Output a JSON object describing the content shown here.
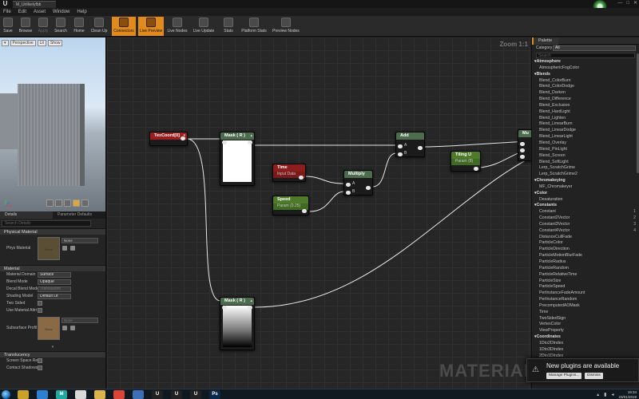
{
  "titlebar": {
    "logo": "U",
    "tab_title": "M_Unlikelyfbb",
    "min": "—",
    "max": "□",
    "close": "✕"
  },
  "menu": [
    "File",
    "Edit",
    "Asset",
    "Window",
    "Help"
  ],
  "toolbar": [
    {
      "label": "Save",
      "icon": "save-icon",
      "state": "normal"
    },
    {
      "label": "Browse",
      "icon": "browse-icon",
      "state": "normal"
    },
    {
      "label": "Apply",
      "icon": "apply-icon",
      "state": "dim"
    },
    {
      "label": "Search",
      "icon": "search-icon",
      "state": "normal"
    },
    {
      "label": "Home",
      "icon": "home-icon",
      "state": "normal"
    },
    {
      "label": "Clean Up",
      "icon": "cleanup-icon",
      "state": "normal"
    },
    {
      "label": "Connectors",
      "icon": "connectors-icon",
      "state": "active"
    },
    {
      "label": "Live Preview",
      "icon": "live-preview-icon",
      "state": "active"
    },
    {
      "label": "Live Nodes",
      "icon": "live-nodes-icon",
      "state": "normal"
    },
    {
      "label": "Live Update",
      "icon": "live-update-icon",
      "state": "normal"
    },
    {
      "label": "Stats",
      "icon": "stats-icon",
      "state": "normal"
    },
    {
      "label": "Platform Stats",
      "icon": "platform-stats-icon",
      "state": "normal"
    },
    {
      "label": "Preview Nodes",
      "icon": "preview-nodes-icon",
      "state": "normal"
    }
  ],
  "viewport": {
    "perspective": "Perspective",
    "lit": "Lit",
    "show": "Show"
  },
  "details": {
    "tabs": [
      "Details",
      "Parameter Defaults"
    ],
    "search_placeholder": "Search Details",
    "physical_section": "Physical Material",
    "phys_material_label": "Phys Material",
    "phys_material_value": "None",
    "phys_thumb_text": "None",
    "material_section": "Material",
    "props": [
      {
        "label": "Material Domain",
        "value": "Surface",
        "dim": false
      },
      {
        "label": "Blend Mode",
        "value": "Opaque",
        "dim": false
      },
      {
        "label": "Decal Blend Mode",
        "value": "Translucent",
        "dim": true
      },
      {
        "label": "Shading Model",
        "value": "Default Lit",
        "dim": false
      }
    ],
    "two_sided": "Two Sided",
    "use_attrs": "Use Material Attri",
    "subsurface_label": "Subsurface Profil",
    "subsurface_value": "None",
    "subsurface_thumb_text": "None",
    "translucency_section": "Translucency",
    "screen_space": "Screen Space Ref",
    "contact_shadows": "Contact Shadows"
  },
  "graph": {
    "zoom": "Zoom 1:1",
    "watermark": "MATERIAL",
    "nodes": {
      "texcoord": {
        "title": "TexCoord[0]"
      },
      "mask_rg": {
        "title": "Mask ( R )"
      },
      "time": {
        "title": "Time",
        "subtitle": "Input Data"
      },
      "speed": {
        "title": "Speed",
        "subtitle": "Param (0.25)"
      },
      "multiply": {
        "title": "Multiply",
        "pin_a": "A",
        "pin_b": "B"
      },
      "add": {
        "title": "Add",
        "pin_a": "A",
        "pin_b": "B"
      },
      "tiling": {
        "title": "Tiling U",
        "subtitle": "Param (8)"
      },
      "mask_r2": {
        "title": "Mask ( R )"
      },
      "edge": {
        "title": "Mu"
      }
    }
  },
  "palette": {
    "tab": "Palette",
    "category_label": "Category",
    "category_value": "All",
    "search_placeholder": "Search",
    "items": [
      {
        "text": "Atmosphere",
        "cat": true,
        "sc": ""
      },
      {
        "text": "AtmosphericFogColor",
        "cat": false,
        "sc": ""
      },
      {
        "text": "Blends",
        "cat": true,
        "sc": ""
      },
      {
        "text": "Blend_ColorBurn",
        "cat": false,
        "sc": ""
      },
      {
        "text": "Blend_ColorDodge",
        "cat": false,
        "sc": ""
      },
      {
        "text": "Blend_Darken",
        "cat": false,
        "sc": ""
      },
      {
        "text": "Blend_Difference",
        "cat": false,
        "sc": ""
      },
      {
        "text": "Blend_Exclusion",
        "cat": false,
        "sc": ""
      },
      {
        "text": "Blend_HardLight",
        "cat": false,
        "sc": ""
      },
      {
        "text": "Blend_Lighten",
        "cat": false,
        "sc": ""
      },
      {
        "text": "Blend_LinearBurn",
        "cat": false,
        "sc": ""
      },
      {
        "text": "Blend_LinearDodge",
        "cat": false,
        "sc": ""
      },
      {
        "text": "Blend_LinearLight",
        "cat": false,
        "sc": ""
      },
      {
        "text": "Blend_Overlay",
        "cat": false,
        "sc": ""
      },
      {
        "text": "Blend_PinLight",
        "cat": false,
        "sc": ""
      },
      {
        "text": "Blend_Screen",
        "cat": false,
        "sc": ""
      },
      {
        "text": "Blend_SoftLight",
        "cat": false,
        "sc": ""
      },
      {
        "text": "Lerp_ScratchGrime",
        "cat": false,
        "sc": ""
      },
      {
        "text": "Lerp_ScratchGrime2",
        "cat": false,
        "sc": ""
      },
      {
        "text": "Chromakeying",
        "cat": true,
        "sc": ""
      },
      {
        "text": "MF_Chromakeyer",
        "cat": false,
        "sc": ""
      },
      {
        "text": "Color",
        "cat": true,
        "sc": ""
      },
      {
        "text": "Desaturation",
        "cat": false,
        "sc": ""
      },
      {
        "text": "Constants",
        "cat": true,
        "sc": ""
      },
      {
        "text": "Constant",
        "cat": false,
        "sc": "1"
      },
      {
        "text": "Constant2Vector",
        "cat": false,
        "sc": "2"
      },
      {
        "text": "Constant3Vector",
        "cat": false,
        "sc": "3"
      },
      {
        "text": "Constant4Vector",
        "cat": false,
        "sc": "4"
      },
      {
        "text": "DistanceCullFade",
        "cat": false,
        "sc": ""
      },
      {
        "text": "ParticleColor",
        "cat": false,
        "sc": ""
      },
      {
        "text": "ParticleDirection",
        "cat": false,
        "sc": ""
      },
      {
        "text": "ParticleMotionBlurFade",
        "cat": false,
        "sc": ""
      },
      {
        "text": "ParticleRadius",
        "cat": false,
        "sc": ""
      },
      {
        "text": "ParticleRandom",
        "cat": false,
        "sc": ""
      },
      {
        "text": "ParticleRelativeTime",
        "cat": false,
        "sc": ""
      },
      {
        "text": "ParticleSize",
        "cat": false,
        "sc": ""
      },
      {
        "text": "ParticleSpeed",
        "cat": false,
        "sc": ""
      },
      {
        "text": "PerInstanceFadeAmount",
        "cat": false,
        "sc": ""
      },
      {
        "text": "PerInstanceRandom",
        "cat": false,
        "sc": ""
      },
      {
        "text": "PrecomputedAOMask",
        "cat": false,
        "sc": ""
      },
      {
        "text": "Time",
        "cat": false,
        "sc": ""
      },
      {
        "text": "TwoSidedSign",
        "cat": false,
        "sc": ""
      },
      {
        "text": "VertexColor",
        "cat": false,
        "sc": ""
      },
      {
        "text": "ViewProperty",
        "cat": false,
        "sc": ""
      },
      {
        "text": "Coordinates",
        "cat": true,
        "sc": ""
      },
      {
        "text": "1Dto2DIndex",
        "cat": false,
        "sc": ""
      },
      {
        "text": "1Dto3DIndex",
        "cat": false,
        "sc": ""
      },
      {
        "text": "2Dto1DIndex",
        "cat": false,
        "sc": ""
      }
    ]
  },
  "notification": {
    "text": "New plugins are available",
    "manage": "Manage Plugins...",
    "dismiss": "Dismiss"
  },
  "taskbar": {
    "apps": [
      {
        "icon": "folder-icon",
        "label": "",
        "color": "#c9a227"
      },
      {
        "icon": "media-icon",
        "label": "",
        "color": "#2d7fd1"
      },
      {
        "icon": "maya-icon",
        "label": "M",
        "color": "#1fa7a0"
      },
      {
        "icon": "file-icon",
        "label": "",
        "color": "#d8d8d8"
      },
      {
        "icon": "folder2-icon",
        "label": "",
        "color": "#d9b44a"
      },
      {
        "icon": "chrome-icon",
        "label": "",
        "color": "#db4437"
      },
      {
        "icon": "utility-icon",
        "label": "",
        "color": "#3c6fb6"
      },
      {
        "icon": "ue-icon-1",
        "label": "U",
        "color": "#222"
      },
      {
        "icon": "ue-icon-2",
        "label": "U",
        "color": "#222"
      },
      {
        "icon": "ue-icon-3",
        "label": "U",
        "color": "#222"
      },
      {
        "icon": "photoshop-icon",
        "label": "Ps",
        "color": "#0b2a4a"
      }
    ],
    "time": "19:34",
    "date": "23/01/2019"
  }
}
